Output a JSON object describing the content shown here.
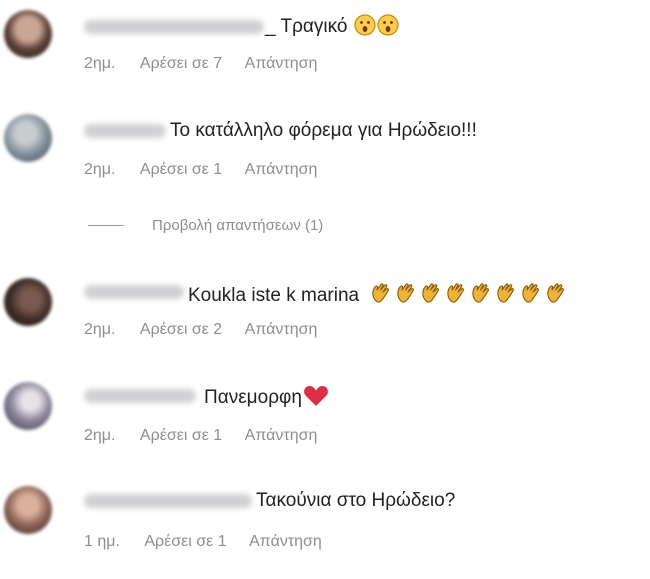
{
  "comments": [
    {
      "text": "_ Τραγικό",
      "emojis": [
        "surprised-face",
        "surprised-face"
      ],
      "time": "2ημ.",
      "likes": "Αρέσει σε 7",
      "reply": "Απάντηση",
      "avatar_color": "#6b4b45"
    },
    {
      "text": "Το κατάλληλο φόρεμα για Ηρώδειο!!!",
      "emojis": [],
      "time": "2ημ.",
      "likes": "Αρέσει σε 1",
      "reply": "Απάντηση",
      "avatar_color": "#8a99a4"
    },
    {
      "text": "Koukla iste k marina",
      "emojis": [
        "clapping-hands",
        "clapping-hands",
        "clapping-hands",
        "clapping-hands",
        "clapping-hands",
        "clapping-hands",
        "clapping-hands",
        "clapping-hands"
      ],
      "time": "2ημ.",
      "likes": "Αρέσει σε 2",
      "reply": "Απάντηση",
      "avatar_color": "#4a3a35"
    },
    {
      "text": "Πανεμορφη",
      "emojis": [
        "red-heart"
      ],
      "time": "2ημ.",
      "likes": "Αρέσει σε 1",
      "reply": "Απάντηση",
      "avatar_color": "#6e6a7a"
    },
    {
      "text": "Τακούνια στο Ηρώδειο?",
      "emojis": [],
      "time": "1 ημ.",
      "likes": "Αρέσει σε 1",
      "reply": "Απάντηση",
      "avatar_color": "#9a7565"
    }
  ],
  "view_replies": "Προβολή απαντήσεων (1)",
  "colors": {
    "meta": "#8e8e8e",
    "text": "#222222",
    "clap": "#f0b33a",
    "heart": "#dd2e44",
    "surprise": "#ffcc4d"
  }
}
